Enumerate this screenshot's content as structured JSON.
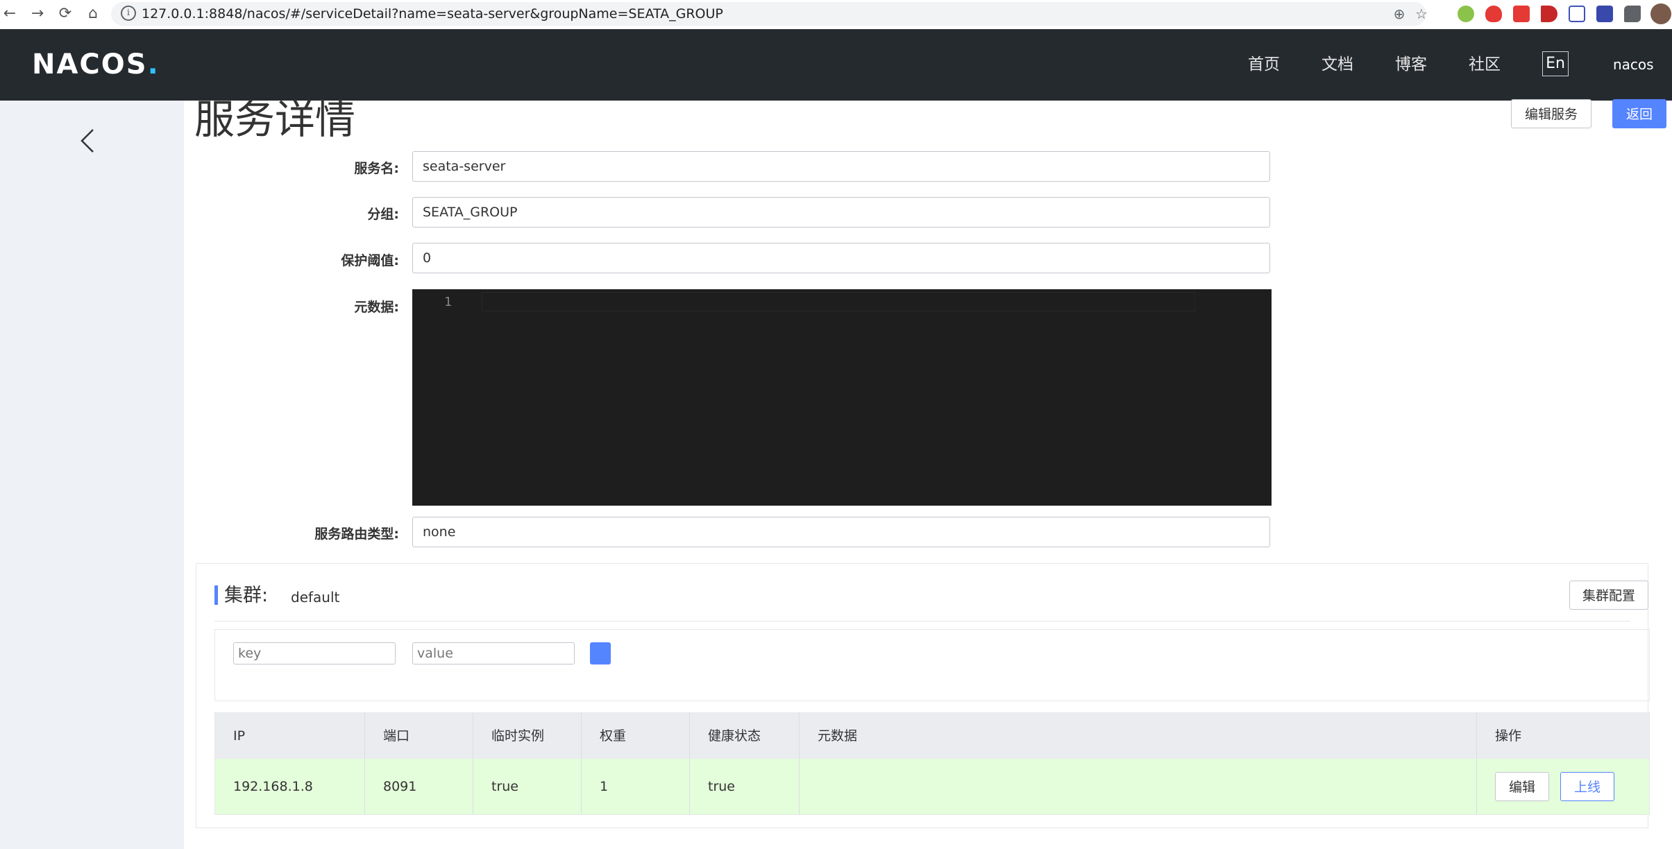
{
  "browser": {
    "url": "127.0.0.1:8848/nacos/#/serviceDetail?name=seata-server&groupName=SEATA_GROUP",
    "back": "←",
    "forward": "→",
    "reload": "⟳",
    "home": "⌂",
    "info": "i",
    "zoom": "⊕",
    "star": "☆"
  },
  "header": {
    "logo_main": "NACOS",
    "logo_dot": ".",
    "nav": [
      "首页",
      "文档",
      "博客",
      "社区"
    ],
    "lang": "En",
    "user": "nacos"
  },
  "page": {
    "title": "服务详情",
    "edit_service": "编辑服务",
    "back": "返回"
  },
  "form": {
    "service_name_label": "服务名:",
    "service_name": "seata-server",
    "group_label": "分组:",
    "group": "SEATA_GROUP",
    "threshold_label": "保护阈值:",
    "threshold": "0",
    "metadata_label": "元数据:",
    "editor_line": "1",
    "selector_label": "服务路由类型:",
    "selector": "none"
  },
  "cluster": {
    "title": "集群:",
    "name": "default",
    "config_button": "集群配置",
    "key_placeholder": "key",
    "value_placeholder": "value",
    "columns": [
      "IP",
      "端口",
      "临时实例",
      "权重",
      "健康状态",
      "元数据",
      "操作"
    ],
    "row": {
      "ip": "192.168.1.8",
      "port": "8091",
      "ephemeral": "true",
      "weight": "1",
      "healthy": "true",
      "metadata": "",
      "edit": "编辑",
      "online": "上线"
    }
  }
}
